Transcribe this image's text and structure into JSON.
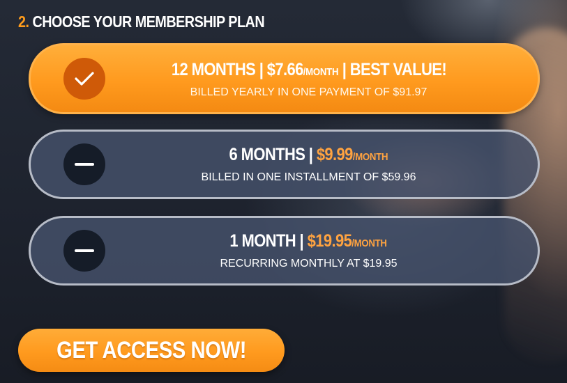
{
  "section": {
    "step_number": "2.",
    "title": "CHOOSE YOUR MEMBERSHIP PLAN"
  },
  "plans": [
    {
      "duration": "12 MONTHS",
      "separator1": " | ",
      "price": "$7.66",
      "per": "/MONTH",
      "separator2": " | ",
      "tag": "BEST VALUE!",
      "billing": "BILLED YEARLY IN ONE PAYMENT OF $91.97",
      "selected": true,
      "icon": "checkmark-icon"
    },
    {
      "duration": "6 MONTHS",
      "separator1": " | ",
      "price": "$9.99",
      "per": "/MONTH",
      "billing": "BILLED IN ONE INSTALLMENT OF $59.96",
      "selected": false,
      "icon": "minus-icon"
    },
    {
      "duration": "1 MONTH",
      "separator1": " | ",
      "price": "$19.95",
      "per": "/MONTH",
      "billing": "RECURRING MONTHLY AT $19.95",
      "selected": false,
      "icon": "minus-icon"
    }
  ],
  "cta": {
    "label": "GET ACCESS NOW!"
  },
  "colors": {
    "accent": "#ff9c1c",
    "selected_indicator": "#cf5a08",
    "card_background": "#45526b",
    "card_border": "#b7bcc7",
    "unselected_indicator": "#151c28"
  }
}
